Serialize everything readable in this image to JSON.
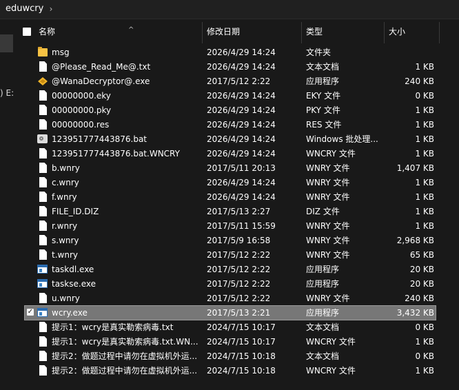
{
  "address": {
    "crumb": "eduwcry",
    "chevron": "›"
  },
  "nav": {
    "partial_label": ") E:"
  },
  "header": {
    "name": "名称",
    "date": "修改日期",
    "type": "类型",
    "size": "大小",
    "sort_caret": "^"
  },
  "files": [
    {
      "name": "msg",
      "date": "2026/4/29 14:24",
      "type": "文件夹",
      "size": "",
      "icon": "folder-icon"
    },
    {
      "name": "@Please_Read_Me@.txt",
      "date": "2026/4/29 14:24",
      "type": "文本文档",
      "size": "1 KB",
      "icon": "document-icon"
    },
    {
      "name": "@WanaDecryptor@.exe",
      "date": "2017/5/12 2:22",
      "type": "应用程序",
      "size": "240 KB",
      "icon": "wanadecryptor-icon"
    },
    {
      "name": "00000000.eky",
      "date": "2026/4/29 14:24",
      "type": "EKY 文件",
      "size": "0 KB",
      "icon": "document-icon"
    },
    {
      "name": "00000000.pky",
      "date": "2026/4/29 14:24",
      "type": "PKY 文件",
      "size": "1 KB",
      "icon": "document-icon"
    },
    {
      "name": "00000000.res",
      "date": "2026/4/29 14:24",
      "type": "RES 文件",
      "size": "1 KB",
      "icon": "document-icon"
    },
    {
      "name": "123951777443876.bat",
      "date": "2026/4/29 14:24",
      "type": "Windows 批处理...",
      "size": "1 KB",
      "icon": "batch-file-icon"
    },
    {
      "name": "123951777443876.bat.WNCRY",
      "date": "2026/4/29 14:24",
      "type": "WNCRY 文件",
      "size": "1 KB",
      "icon": "document-icon"
    },
    {
      "name": "b.wnry",
      "date": "2017/5/11 20:13",
      "type": "WNRY 文件",
      "size": "1,407 KB",
      "icon": "document-icon"
    },
    {
      "name": "c.wnry",
      "date": "2026/4/29 14:24",
      "type": "WNRY 文件",
      "size": "1 KB",
      "icon": "document-icon"
    },
    {
      "name": "f.wnry",
      "date": "2026/4/29 14:24",
      "type": "WNRY 文件",
      "size": "1 KB",
      "icon": "document-icon"
    },
    {
      "name": "FILE_ID.DIZ",
      "date": "2017/5/13 2:27",
      "type": "DIZ 文件",
      "size": "1 KB",
      "icon": "document-icon"
    },
    {
      "name": "r.wnry",
      "date": "2017/5/11 15:59",
      "type": "WNRY 文件",
      "size": "1 KB",
      "icon": "document-icon"
    },
    {
      "name": "s.wnry",
      "date": "2017/5/9 16:58",
      "type": "WNRY 文件",
      "size": "2,968 KB",
      "icon": "document-icon"
    },
    {
      "name": "t.wnry",
      "date": "2017/5/12 2:22",
      "type": "WNRY 文件",
      "size": "65 KB",
      "icon": "document-icon"
    },
    {
      "name": "taskdl.exe",
      "date": "2017/5/12 2:22",
      "type": "应用程序",
      "size": "20 KB",
      "icon": "application-icon"
    },
    {
      "name": "taskse.exe",
      "date": "2017/5/12 2:22",
      "type": "应用程序",
      "size": "20 KB",
      "icon": "application-icon"
    },
    {
      "name": "u.wnry",
      "date": "2017/5/12 2:22",
      "type": "WNRY 文件",
      "size": "240 KB",
      "icon": "document-icon"
    },
    {
      "name": "wcry.exe",
      "date": "2017/5/13 2:21",
      "type": "应用程序",
      "size": "3,432 KB",
      "icon": "application-icon",
      "selected": true
    },
    {
      "name": "提示1：wcry是真实勒索病毒.txt",
      "date": "2024/7/15 10:17",
      "type": "文本文档",
      "size": "0 KB",
      "icon": "document-icon"
    },
    {
      "name": "提示1：wcry是真实勒索病毒.txt.WN...",
      "date": "2024/7/15 10:17",
      "type": "WNCRY 文件",
      "size": "1 KB",
      "icon": "document-icon"
    },
    {
      "name": "提示2：做题过程中请勿在虚拟机外运...",
      "date": "2024/7/15 10:18",
      "type": "文本文档",
      "size": "0 KB",
      "icon": "document-icon"
    },
    {
      "name": "提示2：做题过程中请勿在虚拟机外运...",
      "date": "2024/7/15 10:18",
      "type": "WNCRY 文件",
      "size": "1 KB",
      "icon": "document-icon"
    }
  ]
}
